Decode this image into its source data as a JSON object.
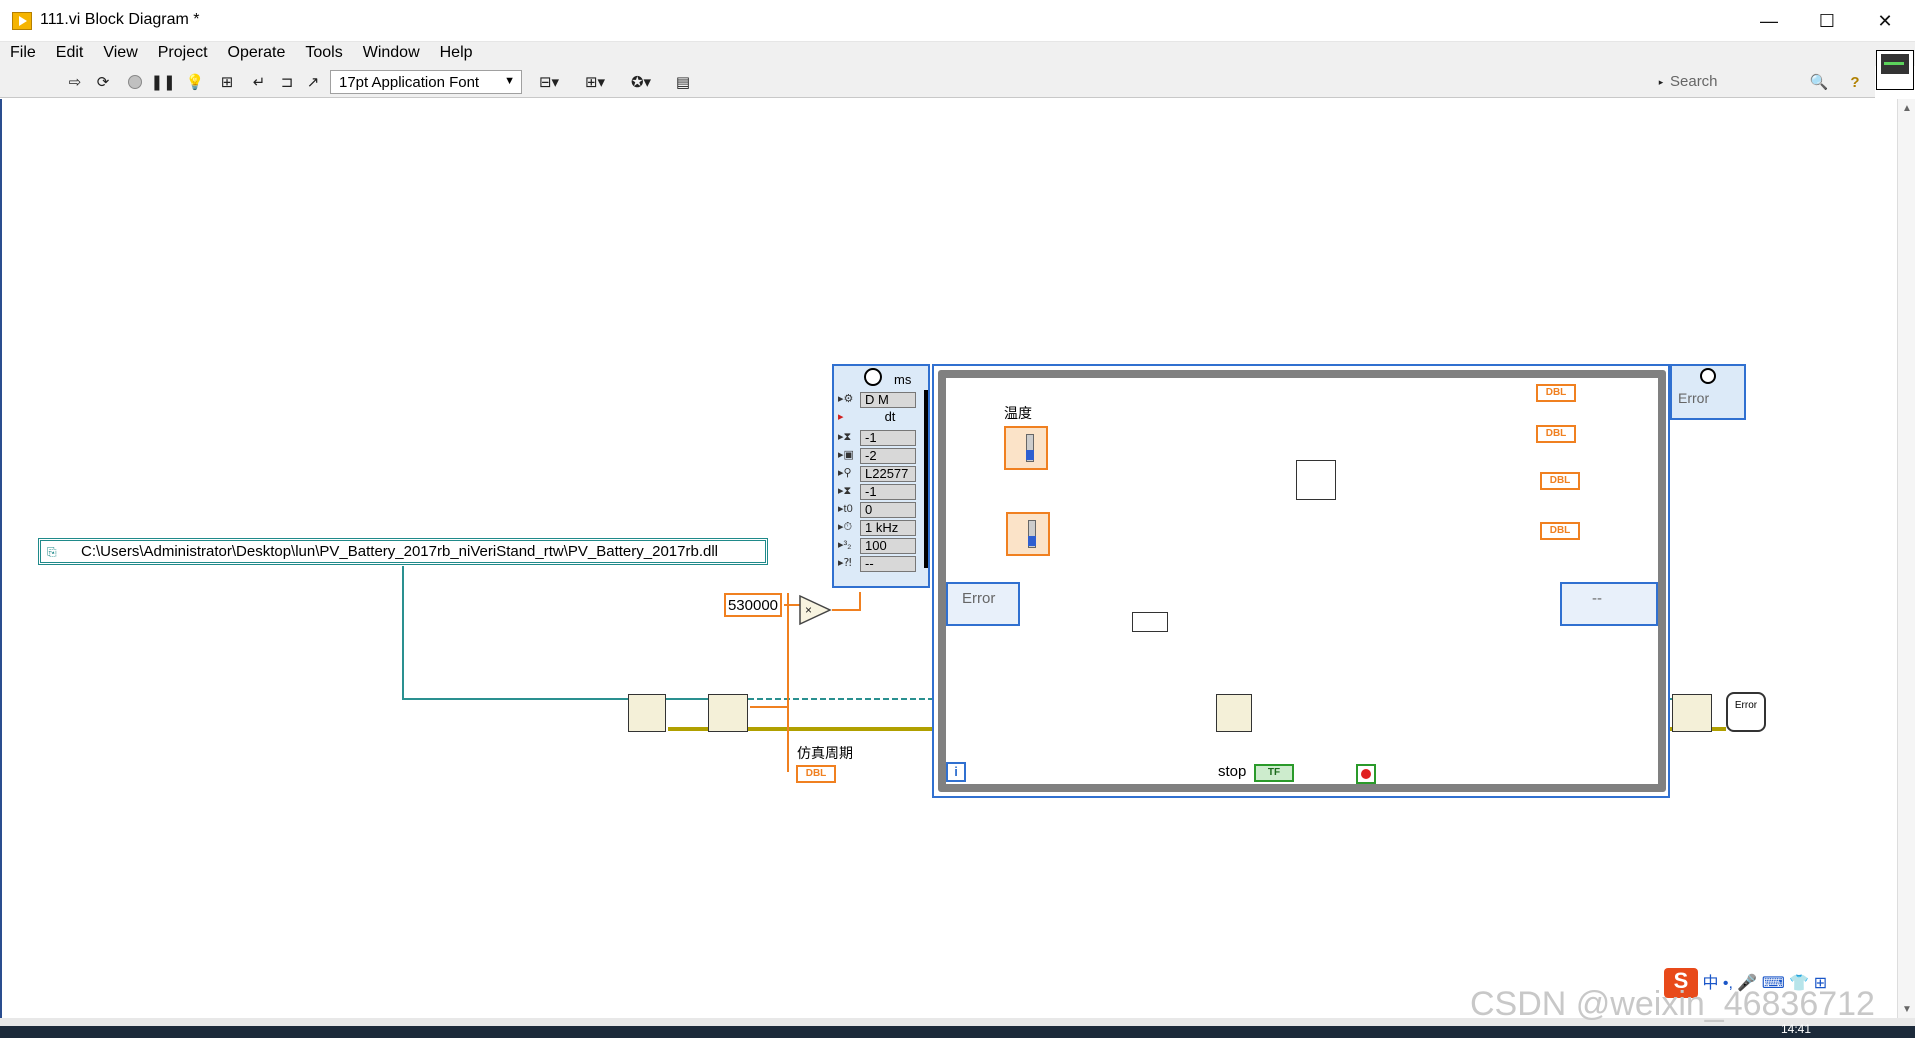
{
  "window": {
    "title": "111.vi Block Diagram *",
    "controls": {
      "minimize": "—",
      "maximize": "☐",
      "close": "✕"
    }
  },
  "menu": [
    "File",
    "Edit",
    "View",
    "Project",
    "Operate",
    "Tools",
    "Window",
    "Help"
  ],
  "toolbar": {
    "font": "17pt Application Font",
    "search_placeholder": "Search",
    "icons": [
      "run-arrow-icon",
      "run-continuously-icon",
      "abort-icon",
      "pause-icon",
      "highlight-bulb-icon",
      "retain-wire-icon",
      "step-into-icon",
      "step-over-icon",
      "step-out-icon",
      "align-icon",
      "distribute-icon",
      "reorder-icon",
      "cleanup-icon",
      "search-icon",
      "help-icon"
    ]
  },
  "diagram": {
    "dll_path": "C:\\Users\\Administrator\\Desktop\\lun\\PV_Battery_2017rb_niVeriStand_rtw\\PV_Battery_2017rb.dll",
    "constant": "530000",
    "sim_period_label": "仿真周期",
    "temp_label": "温度",
    "dbl_label": "DBL",
    "timed_loop": {
      "unit": "ms",
      "config_rows": [
        "D M",
        "dt",
        "-1",
        "-2",
        "L22577",
        "-1",
        "0",
        "1 kHz",
        "100",
        "--"
      ],
      "error_label": "Error",
      "right_error_label": "Error",
      "right_status": "--",
      "iteration": "i",
      "stop_label": "stop",
      "stop_bool": "TF"
    },
    "error_dialog_label": "Error"
  },
  "watermark": "CSDN @weixin_46836712",
  "taskbar": {
    "clock": "14:41"
  },
  "ime": {
    "logo": "S",
    "lang": "中"
  },
  "colors": {
    "double_wire": "#f08020",
    "path_wire": "#2a9090",
    "loop_border": "#3070d0",
    "error_wire": "#c8b400"
  }
}
